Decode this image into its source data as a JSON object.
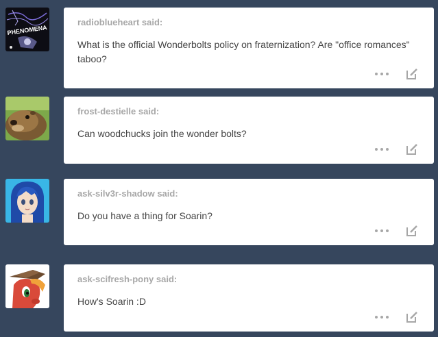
{
  "posts": [
    {
      "asker": "radioblueheart said:",
      "question": "What is the official Wonderbolts policy on fraternization? Are \"office romances\" taboo?",
      "avatar": "phenomena-logo-avatar",
      "avatar_text": "PHENOMENA"
    },
    {
      "asker": "frost-destielle said:",
      "question": "Can woodchucks join the wonder bolts?",
      "avatar": "woodchuck-photo-avatar"
    },
    {
      "asker": "ask-silv3r-shadow said:",
      "question": "Do you have a thing for Soarin?",
      "avatar": "blue-haired-anime-girl-avatar"
    },
    {
      "asker": "ask-scifresh-pony said:",
      "question": "How's Soarin :D",
      "avatar": "red-pony-avatar"
    }
  ],
  "icons": {
    "more": "ellipsis-icon",
    "edit": "edit-icon"
  },
  "colors": {
    "background": "#36465d",
    "card": "#ffffff",
    "asker": "#a7a7a7",
    "text": "#444444"
  }
}
